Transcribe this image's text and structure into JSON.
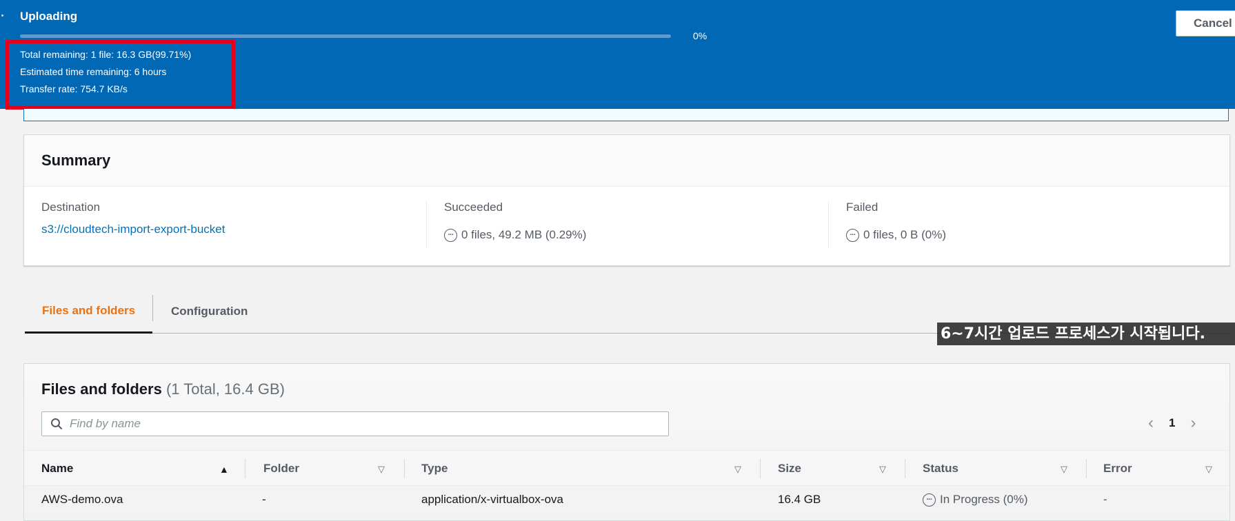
{
  "banner": {
    "title": "Uploading",
    "progress": 0,
    "progress_text": "0%",
    "total_remaining": "Total remaining: 1 file: 16.3 GB(99.71%)",
    "time_remaining": "Estimated time remaining: 6 hours",
    "transfer_rate": "Transfer rate: 754.7 KB/s",
    "cancel_label": "Cancel",
    "highlight_color": "#e3001b",
    "background_color": "#0168b6"
  },
  "summary": {
    "title": "Summary",
    "destination_label": "Destination",
    "destination_value": "s3://cloudtech-import-export-bucket",
    "succeeded_label": "Succeeded",
    "succeeded_value": "0 files, 49.2 MB (0.29%)",
    "failed_label": "Failed",
    "failed_value": "0 files, 0 B (0%)",
    "status_icon": "in-progress-icon"
  },
  "tabs": [
    {
      "label": "Files and folders",
      "active": true
    },
    {
      "label": "Configuration",
      "active": false
    }
  ],
  "caption": "6~7시간 업로드 프로세스가 시작됩니다.",
  "files": {
    "title": "Files and folders",
    "count": "(1 Total, 16.4 GB)",
    "search_placeholder": "Find by name",
    "page": "1",
    "columns": [
      "Name",
      "Folder",
      "Type",
      "Size",
      "Status",
      "Error"
    ],
    "rows": [
      {
        "name": "AWS-demo.ova",
        "folder": "-",
        "type": "application/x-virtualbox-ova",
        "size": "16.4 GB",
        "status": "In Progress (0%)",
        "error": "-"
      }
    ]
  },
  "accent_color": "#ec7211",
  "link_color": "#0073bb"
}
